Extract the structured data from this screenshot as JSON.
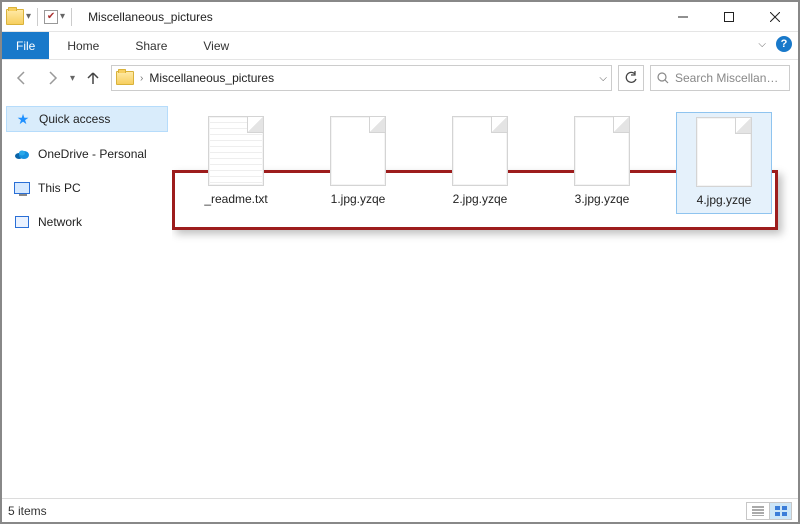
{
  "window": {
    "title": "Miscellaneous_pictures"
  },
  "ribbon": {
    "file": "File",
    "tabs": [
      "Home",
      "Share",
      "View"
    ]
  },
  "address": {
    "crumb": "Miscellaneous_pictures"
  },
  "search": {
    "placeholder": "Search Miscellane..."
  },
  "sidebar": {
    "quick_access": "Quick access",
    "onedrive": "OneDrive - Personal",
    "this_pc": "This PC",
    "network": "Network"
  },
  "files": [
    {
      "name": "_readme.txt",
      "type": "text",
      "selected": false
    },
    {
      "name": "1.jpg.yzqe",
      "type": "blank",
      "selected": false
    },
    {
      "name": "2.jpg.yzqe",
      "type": "blank",
      "selected": false
    },
    {
      "name": "3.jpg.yzqe",
      "type": "blank",
      "selected": false
    },
    {
      "name": "4.jpg.yzqe",
      "type": "blank",
      "selected": true
    }
  ],
  "status": {
    "item_count": "5 items"
  }
}
